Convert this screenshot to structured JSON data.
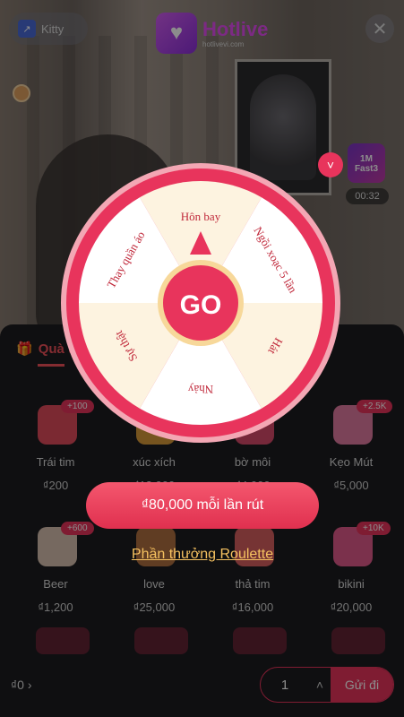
{
  "header": {
    "user_name": "Kitty",
    "user_badge": "↗",
    "logo_title": "Hotlive",
    "logo_url": "hotlivevi.com",
    "close_glyph": "✕"
  },
  "side": {
    "game_label_line1": "1M",
    "game_label_line2": "Fast3",
    "game_timer": "00:32",
    "collapse_glyph": "˅"
  },
  "roulette": {
    "go_label": "GO",
    "segments": [
      "Hôn bay",
      "Ngồi xoạc 5 lần",
      "Hát",
      "Nhảy",
      "Sự thật",
      "Thay quần áo"
    ],
    "draw_button": "₫80,000 mỗi lần rút",
    "prize_link": "Phần thưởng Roulette"
  },
  "gift_panel": {
    "tab_label": "Quà tặng",
    "gifts": [
      {
        "name": "Trái tim",
        "price": "₫200",
        "badge": "+100",
        "color": "#e04c5c"
      },
      {
        "name": "xúc xích",
        "price": "₫12,000",
        "badge": "",
        "color": "#d89a3a"
      },
      {
        "name": "bờ môi",
        "price": "₫4,000",
        "badge": "",
        "color": "#d84a6a"
      },
      {
        "name": "Kẹo Mút",
        "price": "₫5,000",
        "badge": "+2.5K",
        "color": "#e07aa0"
      },
      {
        "name": "Beer",
        "price": "₫1,200",
        "badge": "+600",
        "color": "#d8c0b0"
      },
      {
        "name": "love",
        "price": "₫25,000",
        "badge": "",
        "color": "#b07040"
      },
      {
        "name": "thả tim",
        "price": "₫16,000",
        "badge": "",
        "color": "#d86060"
      },
      {
        "name": "bikini",
        "price": "₫20,000",
        "badge": "+10K",
        "color": "#e05a8a"
      }
    ]
  },
  "bottom": {
    "balance": "₫0 ›",
    "quantity": "1",
    "qty_up_glyph": "˄",
    "send_label": "Gửi đi"
  },
  "colors": {
    "accent": "#e8345c",
    "wheel_rim": "#e8345c",
    "segment_light": "#fdf3e0",
    "segment_white": "#ffffff",
    "segment_text": "#c0283a",
    "link": "#f5c160"
  }
}
